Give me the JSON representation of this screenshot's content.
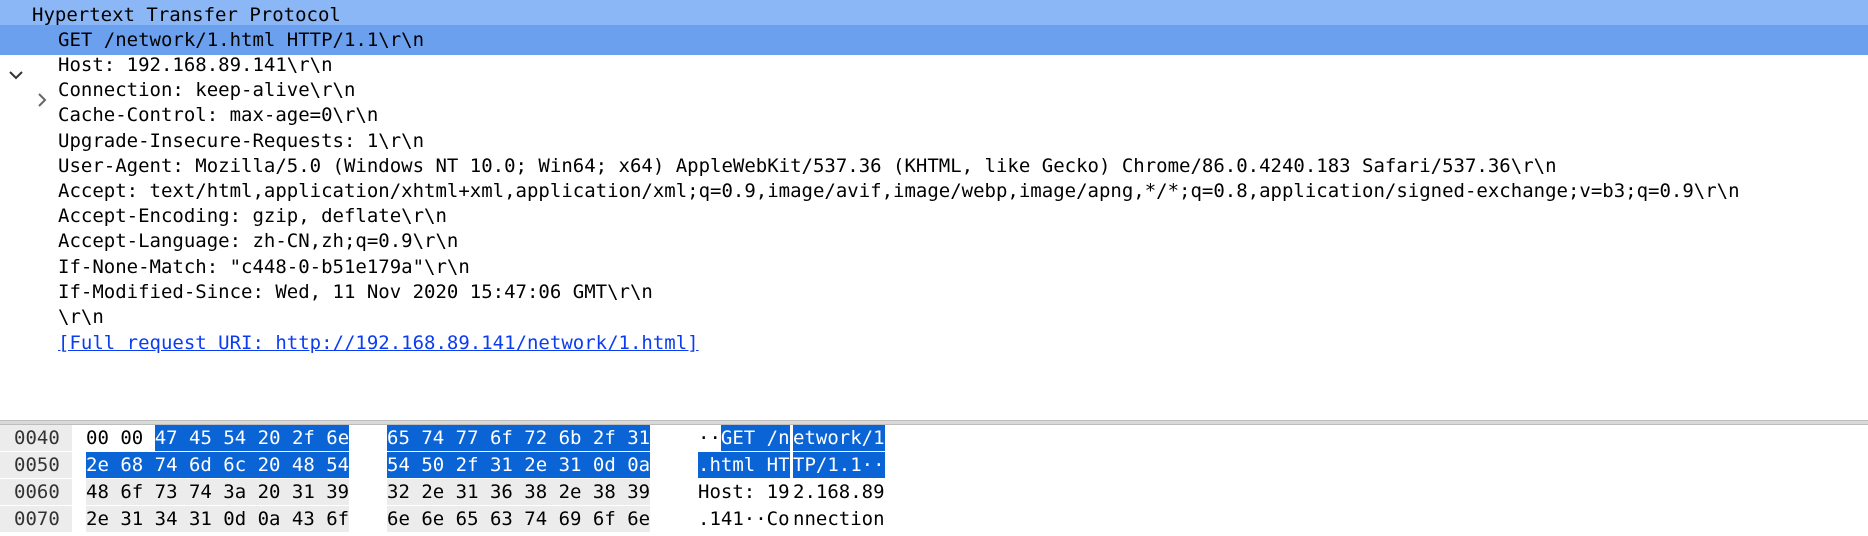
{
  "tree": {
    "header": "Hypertext Transfer Protocol",
    "request_line": "GET /network/1.html HTTP/1.1\\r\\n",
    "fields": [
      "Host: 192.168.89.141\\r\\n",
      "Connection: keep-alive\\r\\n",
      "Cache-Control: max-age=0\\r\\n",
      "Upgrade-Insecure-Requests: 1\\r\\n",
      "User-Agent: Mozilla/5.0 (Windows NT 10.0; Win64; x64) AppleWebKit/537.36 (KHTML, like Gecko) Chrome/86.0.4240.183 Safari/537.36\\r\\n",
      "Accept: text/html,application/xhtml+xml,application/xml;q=0.9,image/avif,image/webp,image/apng,*/*;q=0.8,application/signed-exchange;v=b3;q=0.9\\r\\n",
      "Accept-Encoding: gzip, deflate\\r\\n",
      "Accept-Language: zh-CN,zh;q=0.9\\r\\n",
      "If-None-Match: \"c448-0-b51e179a\"\\r\\n",
      "If-Modified-Since: Wed, 11 Nov 2020 15:47:06 GMT\\r\\n",
      "\\r\\n"
    ],
    "full_uri": "[Full request URI: http://192.168.89.141/network/1.html]"
  },
  "bytes": {
    "rows": [
      {
        "offset": "0040",
        "hex1": [
          [
            "00 00 ",
            false
          ],
          [
            "47 45 54 20 2f 6e",
            true
          ]
        ],
        "hex2": [
          [
            "65 74 77 6f 72 6b 2f 31",
            true
          ]
        ],
        "ascii1": [
          [
            "··",
            false
          ],
          [
            "GET /n",
            true
          ]
        ],
        "ascii2": [
          [
            "etwork/1",
            true
          ]
        ]
      },
      {
        "offset": "0050",
        "hex1": [
          [
            "2e 68 74 6d 6c 20 48 54",
            true
          ]
        ],
        "hex2": [
          [
            "54 50 2f 31 2e 31 0d 0a",
            true
          ]
        ],
        "ascii1": [
          [
            ".html HT",
            true
          ]
        ],
        "ascii2": [
          [
            "TP/1.1··",
            true
          ]
        ]
      },
      {
        "offset": "0060",
        "hex1": [
          [
            "48 6f 73 74 3a 20 31 39",
            false
          ]
        ],
        "hex2": [
          [
            "32 2e 31 36 38 2e 38 39",
            false
          ]
        ],
        "ascii1": [
          [
            "Host: 19",
            false
          ]
        ],
        "ascii2": [
          [
            "2.168.89",
            false
          ]
        ]
      },
      {
        "offset": "0070",
        "hex1": [
          [
            "2e 31 34 31 0d 0a 43 6f",
            false
          ]
        ],
        "hex2": [
          [
            "6e 6e 65 63 74 69 6f 6e",
            false
          ]
        ],
        "ascii1": [
          [
            ".141··Co",
            false
          ]
        ],
        "ascii2": [
          [
            "nnection",
            false
          ]
        ]
      }
    ]
  }
}
